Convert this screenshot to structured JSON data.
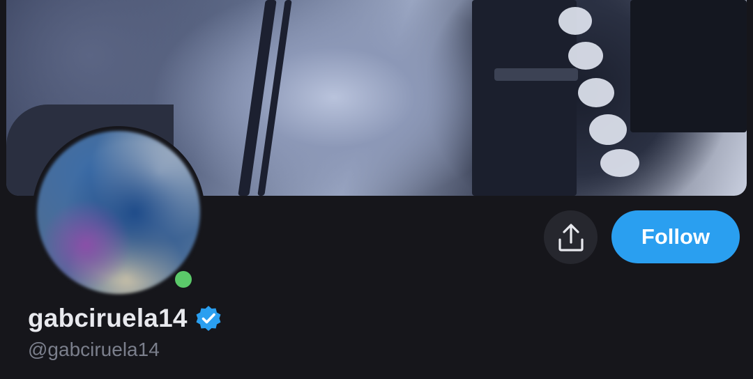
{
  "profile": {
    "display_name": "gabciruela14",
    "handle": "@gabciruela14",
    "verified": true,
    "online": true
  },
  "actions": {
    "follow_label": "Follow",
    "share_icon": "share-upload-icon"
  },
  "colors": {
    "background": "#16161b",
    "follow_button": "#2a9ff0",
    "verified_badge": "#2a9ff0",
    "online_indicator": "#5bc96a",
    "share_button_bg": "#26272e"
  }
}
